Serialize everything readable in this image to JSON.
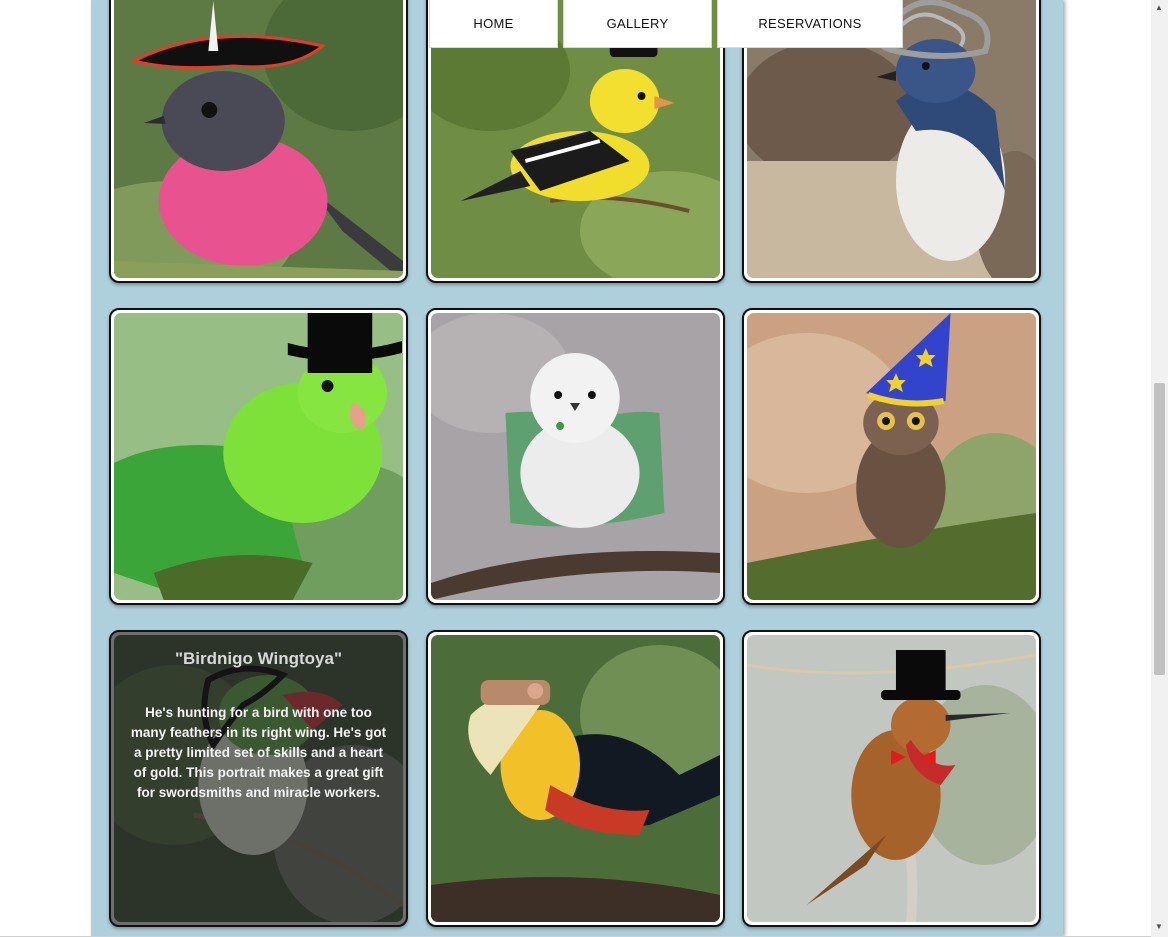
{
  "nav": {
    "items": [
      {
        "label": "HOME"
      },
      {
        "label": "GALLERY"
      },
      {
        "label": "RESERVATIONS"
      }
    ]
  },
  "gallery": {
    "items": [
      {
        "bird": "pink robin",
        "hat": "pirate-hat"
      },
      {
        "bird": "american goldfinch",
        "hat": "small-black-cap"
      },
      {
        "bird": "little penguin",
        "hat": "curly-wig"
      },
      {
        "bird": "green parrotlet",
        "hat": "top-hat"
      },
      {
        "bird": "long-tailed tit",
        "hat": "green-cape"
      },
      {
        "bird": "owlet",
        "hat": "wizard-hat"
      },
      {
        "bird": "tody",
        "hat": "curly-black-wig",
        "hover_title": "\"Birdnigo Wingtoya\"",
        "hover_description": "He's hunting for a bird with one too many feathers in its right wing. He's got a pretty limited set of skills and a heart of gold. This portrait makes a great gift for swordsmiths and miracle workers."
      },
      {
        "bird": "hornbill",
        "hat": "vr-headset"
      },
      {
        "bird": "hummingbird",
        "hat": "top-hat-and-bow-tie"
      }
    ]
  },
  "colors": {
    "page_background": "#aecfdc",
    "card_border": "#111111",
    "nav_background": "#ffffff"
  },
  "icons": {
    "scroll_up": "triangle-up-icon",
    "scroll_down": "triangle-down-icon"
  }
}
